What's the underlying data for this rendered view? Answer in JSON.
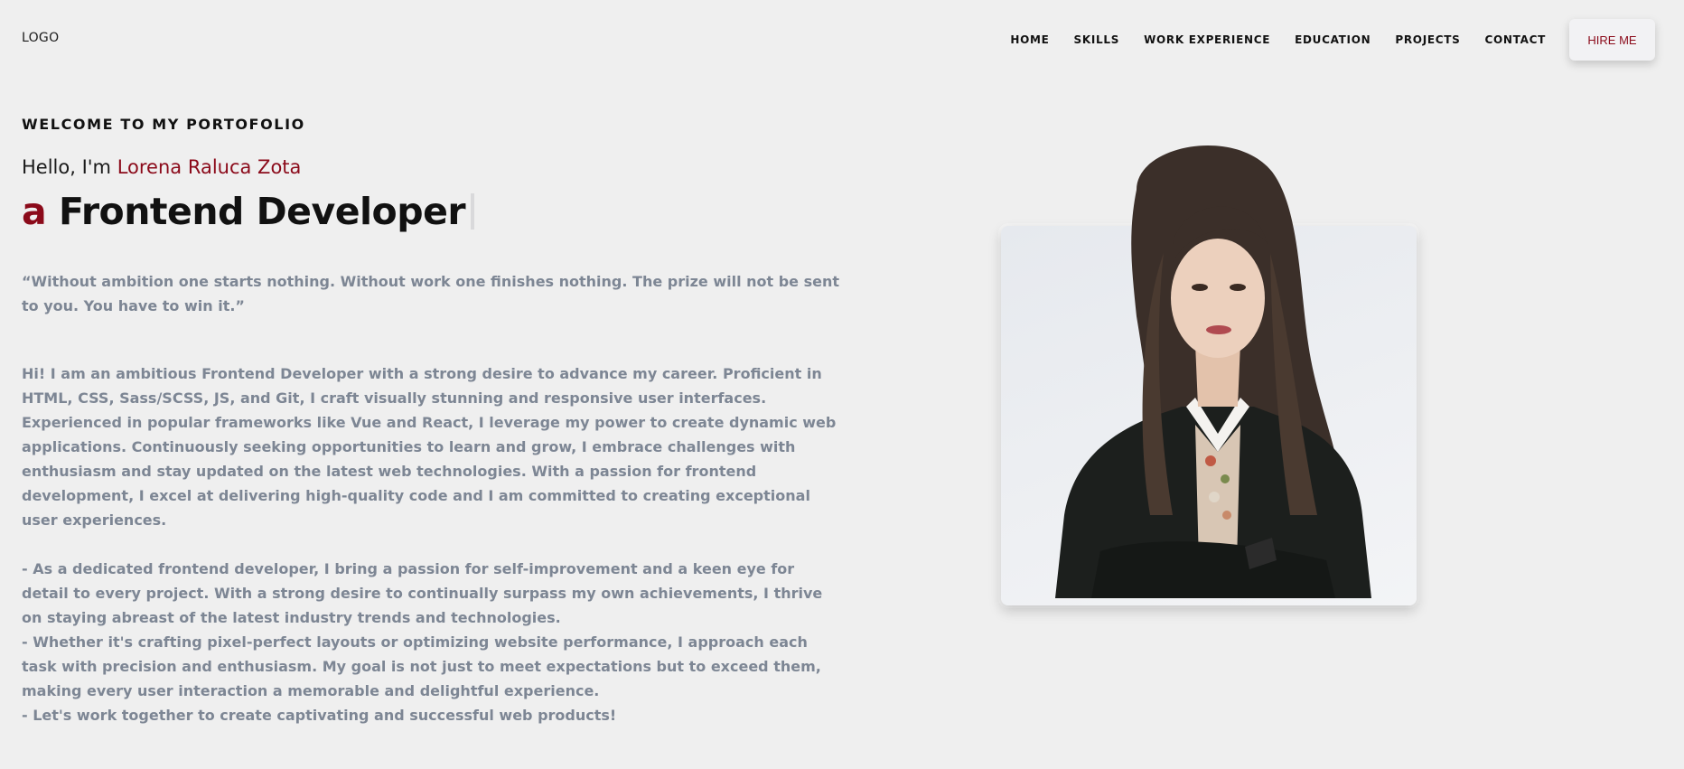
{
  "header": {
    "logo": "LOGO",
    "nav": [
      "HOME",
      "SKILLS",
      "WORK EXPERIENCE",
      "EDUCATION",
      "PROJECTS",
      "CONTACT"
    ],
    "hire_label": "HIRE ME"
  },
  "hero": {
    "welcome": "WELCOME TO MY PORTOFOLIO",
    "hello_prefix": "Hello, I'm",
    "name": "Lorena Raluca Zota",
    "role_article": "a",
    "role_title": "Frontend Developer",
    "quote": "“Without ambition one starts nothing. Without work one finishes nothing. The prize will not be sent to you. You have to win it.”",
    "bio": {
      "intro": "Hi! I am an ambitious Frontend Developer with a strong desire to advance my career. Proficient in HTML, CSS, Sass/SCSS, JS, and Git, I craft visually stunning and responsive user interfaces. Experienced in popular frameworks like Vue and React, I leverage my power to create dynamic web applications. Continuously seeking opportunities to learn and grow, I embrace challenges with enthusiasm and stay updated on the latest web technologies. With a passion for frontend development, I excel at delivering high-quality code and I am committed to creating exceptional user experiences.",
      "point1": "- As a dedicated frontend developer, I bring a passion for self-improvement and a keen eye for detail to every project. With a strong desire to continually surpass my own achievements, I thrive on staying abreast of the latest industry trends and technologies.",
      "point2": "- Whether it's crafting pixel-perfect layouts or optimizing website performance, I approach each task with precision and enthusiasm. My goal is not just to meet expectations but to exceed them, making every user interaction a memorable and delightful experience.",
      "point3": "- Let's work together to create captivating and successful web products!"
    }
  },
  "colors": {
    "background": "#efefef",
    "accent": "#8b0a1a",
    "body_text": "#7d8694"
  }
}
